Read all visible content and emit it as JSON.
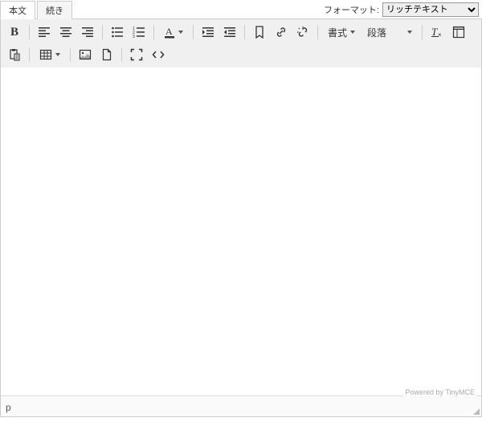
{
  "tabs": {
    "main": "本文",
    "more": "続き"
  },
  "format": {
    "label": "フォーマット:",
    "value": "リッチテキスト"
  },
  "toolbar": {
    "style_label": "書式",
    "block_label": "段落"
  },
  "status": {
    "powered": "Powered by TinyMCE",
    "path": "p"
  }
}
